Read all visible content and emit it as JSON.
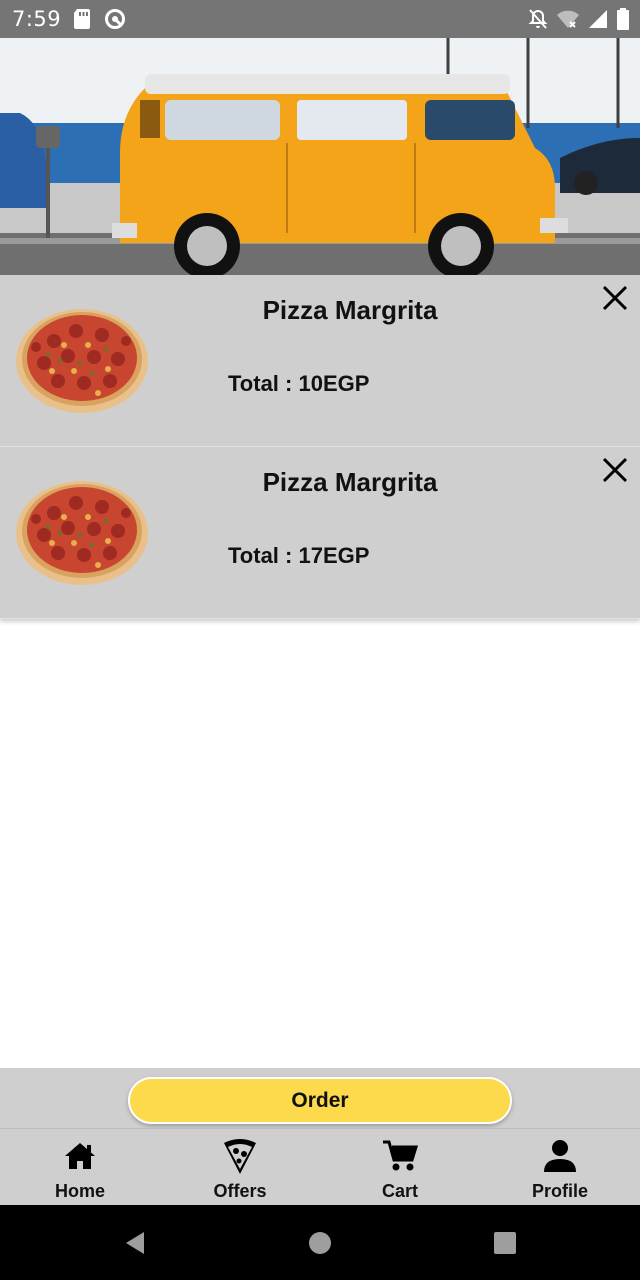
{
  "status_bar": {
    "time": "7:59",
    "icons": [
      "sd-card-icon",
      "data-saver-icon",
      "notifications-off-icon",
      "wifi-icon",
      "signal-icon",
      "battery-icon"
    ]
  },
  "hero": {
    "image": "yellow-van-photo"
  },
  "cart": {
    "items": [
      {
        "name": "Pizza Margrita",
        "total": "Total : 10EGP",
        "image": "pizza-image"
      },
      {
        "name": "Pizza Margrita",
        "total": "Total : 17EGP",
        "image": "pizza-image"
      }
    ]
  },
  "order": {
    "label": "Order"
  },
  "bottom_nav": {
    "items": [
      {
        "label": "Home",
        "icon": "home-icon"
      },
      {
        "label": "Offers",
        "icon": "pizza-slice-icon"
      },
      {
        "label": "Cart",
        "icon": "cart-icon"
      },
      {
        "label": "Profile",
        "icon": "person-icon"
      }
    ]
  },
  "colors": {
    "accent": "#fdd94c",
    "card_background": "#cfcfcf",
    "status_bar": "#757575",
    "system_nav": "#000000"
  }
}
